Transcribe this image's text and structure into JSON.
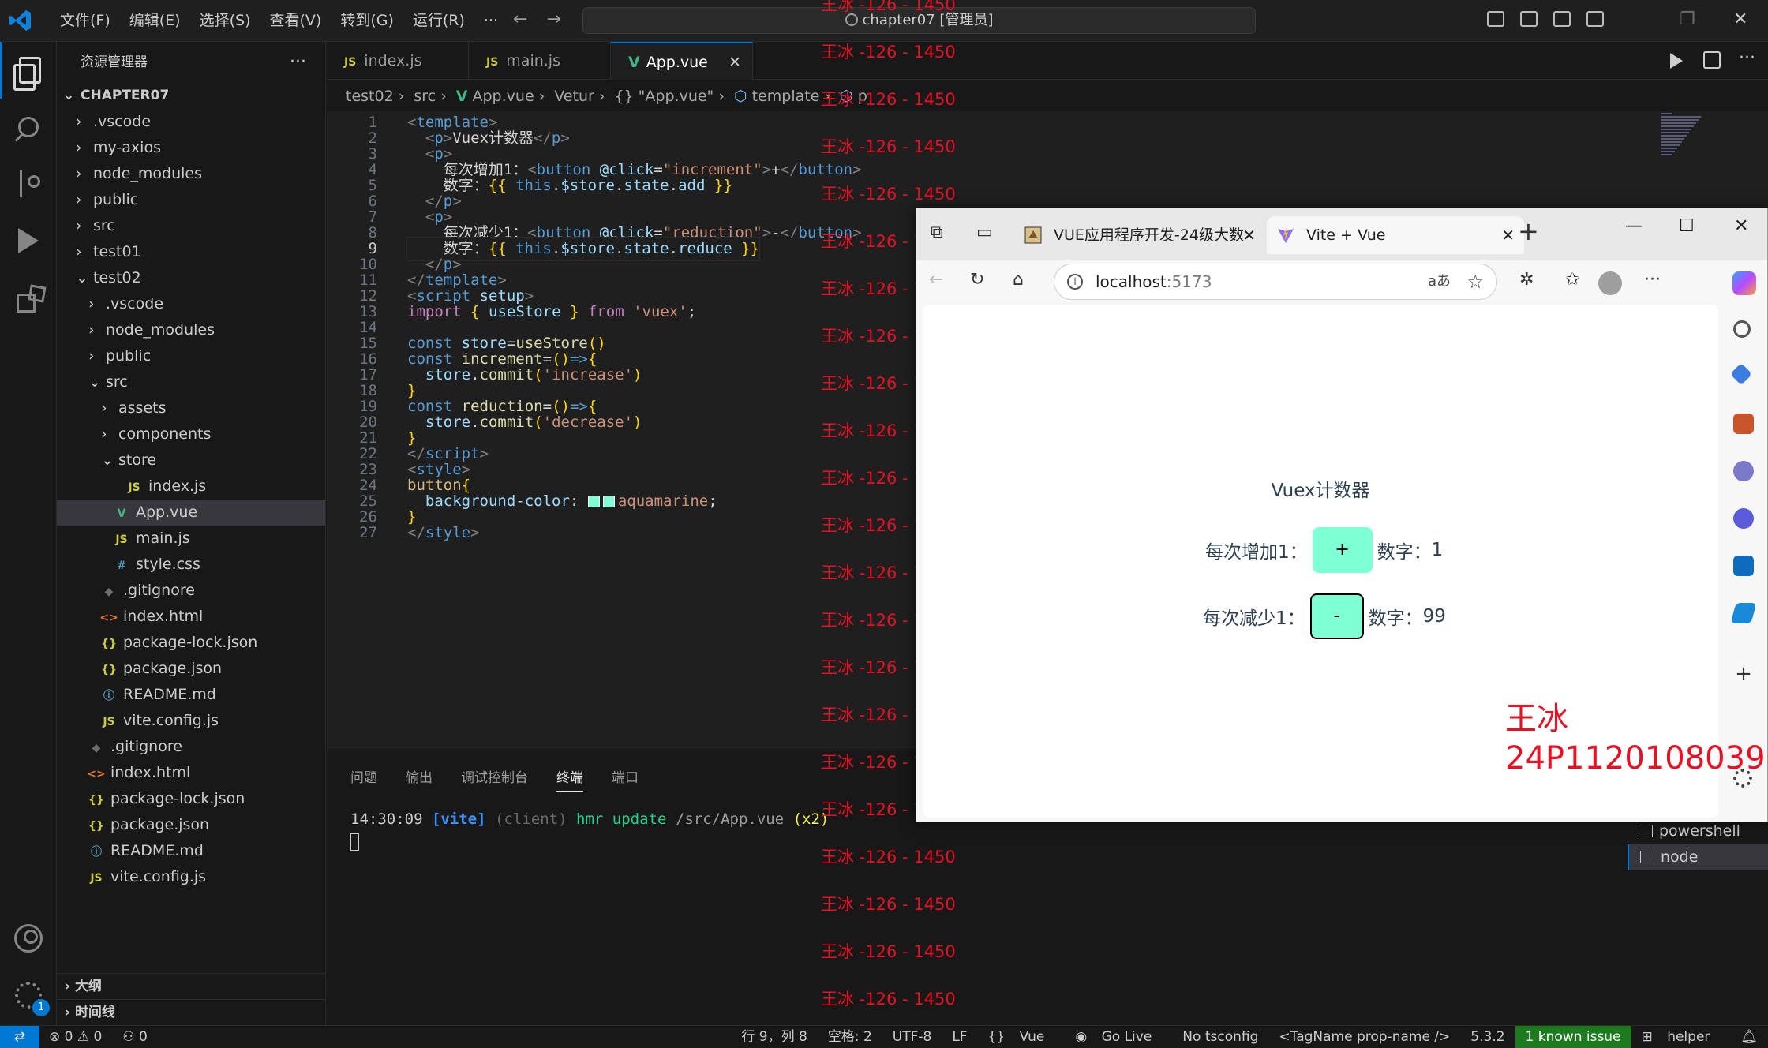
{
  "titlebar": {
    "menu": [
      "文件(F)",
      "编辑(E)",
      "选择(S)",
      "查看(V)",
      "转到(G)",
      "运行(R)",
      "···"
    ],
    "command_center": "chapter07 [管理员]"
  },
  "sidebar": {
    "title": "资源管理器",
    "more": "···",
    "tree": [
      {
        "label": "CHAPTER07",
        "type": "root",
        "depth": 0
      },
      {
        "label": ".vscode",
        "type": "folder",
        "depth": 1
      },
      {
        "label": "my-axios",
        "type": "folder",
        "depth": 1
      },
      {
        "label": "node_modules",
        "type": "folder",
        "depth": 1
      },
      {
        "label": "public",
        "type": "folder",
        "depth": 1
      },
      {
        "label": "src",
        "type": "folder",
        "depth": 1
      },
      {
        "label": "test01",
        "type": "folder",
        "depth": 1
      },
      {
        "label": "test02",
        "type": "folder-open",
        "depth": 1
      },
      {
        "label": ".vscode",
        "type": "folder",
        "depth": 2
      },
      {
        "label": "node_modules",
        "type": "folder",
        "depth": 2
      },
      {
        "label": "public",
        "type": "folder",
        "depth": 2
      },
      {
        "label": "src",
        "type": "folder-open",
        "depth": 2
      },
      {
        "label": "assets",
        "type": "folder",
        "depth": 3
      },
      {
        "label": "components",
        "type": "folder",
        "depth": 3
      },
      {
        "label": "store",
        "type": "folder-open",
        "depth": 3
      },
      {
        "label": "index.js",
        "type": "js",
        "depth": 4
      },
      {
        "label": "App.vue",
        "type": "vue",
        "depth": 3,
        "selected": true
      },
      {
        "label": "main.js",
        "type": "js",
        "depth": 3
      },
      {
        "label": "style.css",
        "type": "css",
        "depth": 3
      },
      {
        "label": ".gitignore",
        "type": "git",
        "depth": 2
      },
      {
        "label": "index.html",
        "type": "html",
        "depth": 2
      },
      {
        "label": "package-lock.json",
        "type": "json",
        "depth": 2
      },
      {
        "label": "package.json",
        "type": "json",
        "depth": 2
      },
      {
        "label": "README.md",
        "type": "info",
        "depth": 2
      },
      {
        "label": "vite.config.js",
        "type": "js",
        "depth": 2
      },
      {
        "label": ".gitignore",
        "type": "git",
        "depth": 1
      },
      {
        "label": "index.html",
        "type": "html",
        "depth": 1
      },
      {
        "label": "package-lock.json",
        "type": "json",
        "depth": 1
      },
      {
        "label": "package.json",
        "type": "json",
        "depth": 1
      },
      {
        "label": "README.md",
        "type": "info",
        "depth": 1
      },
      {
        "label": "vite.config.js",
        "type": "js",
        "depth": 1
      }
    ],
    "outline": "大纲",
    "timeline": "时间线"
  },
  "tabs": [
    {
      "label": "index.js",
      "icon": "JS"
    },
    {
      "label": "main.js",
      "icon": "JS"
    },
    {
      "label": "App.vue",
      "icon": "V",
      "close": "✕"
    }
  ],
  "breadcrumb": [
    "test02",
    "src",
    "App.vue",
    "Vetur",
    "{} \"App.vue\"",
    "template",
    "p"
  ],
  "editor": {
    "current_line": 9,
    "lines": [
      [
        [
          "t-tag",
          "<"
        ],
        [
          "t-tn",
          "template"
        ],
        [
          "t-tag",
          ">"
        ]
      ],
      [
        [
          "t-pl",
          "  "
        ],
        [
          "t-tag",
          "<"
        ],
        [
          "t-tn",
          "p"
        ],
        [
          "t-tag",
          ">"
        ],
        [
          "t-pl",
          "Vuex计数器"
        ],
        [
          "t-tag",
          "</"
        ],
        [
          "t-tn",
          "p"
        ],
        [
          "t-tag",
          ">"
        ]
      ],
      [
        [
          "t-pl",
          "  "
        ],
        [
          "t-tag",
          "<"
        ],
        [
          "t-tn",
          "p"
        ],
        [
          "t-tag",
          ">"
        ]
      ],
      [
        [
          "t-pl",
          "    每次增加1："
        ],
        [
          "t-tag",
          "<"
        ],
        [
          "t-tn",
          "button"
        ],
        [
          "t-pl",
          " "
        ],
        [
          "t-at",
          "@click"
        ],
        [
          "t-pl",
          "="
        ],
        [
          "t-st",
          "\"increment\""
        ],
        [
          "t-tag",
          ">"
        ],
        [
          "t-pl",
          "+"
        ],
        [
          "t-tag",
          "</"
        ],
        [
          "t-tn",
          "button"
        ],
        [
          "t-tag",
          ">"
        ]
      ],
      [
        [
          "t-pl",
          "    数字："
        ],
        [
          "t-br",
          "{{"
        ],
        [
          "t-pl",
          " "
        ],
        [
          "t-kb",
          "this"
        ],
        [
          "t-pl",
          "."
        ],
        [
          "t-vr",
          "$store"
        ],
        [
          "t-pl",
          "."
        ],
        [
          "t-vr",
          "state"
        ],
        [
          "t-pl",
          "."
        ],
        [
          "t-vr",
          "add"
        ],
        [
          "t-pl",
          " "
        ],
        [
          "t-br",
          "}}"
        ]
      ],
      [
        [
          "t-pl",
          "  "
        ],
        [
          "t-tag",
          "</"
        ],
        [
          "t-tn",
          "p"
        ],
        [
          "t-tag",
          ">"
        ]
      ],
      [
        [
          "t-pl",
          "  "
        ],
        [
          "t-tag",
          "<"
        ],
        [
          "t-tn",
          "p"
        ],
        [
          "t-tag",
          ">"
        ]
      ],
      [
        [
          "t-pl",
          "    每次减少1："
        ],
        [
          "t-tag",
          "<"
        ],
        [
          "t-tn",
          "button"
        ],
        [
          "t-pl",
          " "
        ],
        [
          "t-at",
          "@click"
        ],
        [
          "t-pl",
          "="
        ],
        [
          "t-st",
          "\"reduction\""
        ],
        [
          "t-tag",
          ">"
        ],
        [
          "t-pl",
          "-"
        ],
        [
          "t-tag",
          "</"
        ],
        [
          "t-tn",
          "button"
        ],
        [
          "t-tag",
          ">"
        ]
      ],
      [
        [
          "t-pl",
          "    数字："
        ],
        [
          "t-br",
          "{{"
        ],
        [
          "t-pl",
          " "
        ],
        [
          "t-kb",
          "this"
        ],
        [
          "t-pl",
          "."
        ],
        [
          "t-vr",
          "$store"
        ],
        [
          "t-pl",
          "."
        ],
        [
          "t-vr",
          "state"
        ],
        [
          "t-pl",
          "."
        ],
        [
          "t-vr",
          "reduce"
        ],
        [
          "t-pl",
          " "
        ],
        [
          "t-br",
          "}}"
        ]
      ],
      [
        [
          "t-pl",
          "  "
        ],
        [
          "t-tag",
          "</"
        ],
        [
          "t-tn",
          "p"
        ],
        [
          "t-tag",
          ">"
        ]
      ],
      [
        [
          "t-tag",
          "</"
        ],
        [
          "t-tn",
          "template"
        ],
        [
          "t-tag",
          ">"
        ]
      ],
      [
        [
          "t-tag",
          "<"
        ],
        [
          "t-tn",
          "script"
        ],
        [
          "t-pl",
          " "
        ],
        [
          "t-at",
          "setup"
        ],
        [
          "t-tag",
          ">"
        ]
      ],
      [
        [
          "t-kw",
          "import"
        ],
        [
          "t-pl",
          " "
        ],
        [
          "t-br",
          "{"
        ],
        [
          "t-pl",
          " "
        ],
        [
          "t-vr",
          "useStore"
        ],
        [
          "t-pl",
          " "
        ],
        [
          "t-br",
          "}"
        ],
        [
          "t-pl",
          " "
        ],
        [
          "t-kw",
          "from"
        ],
        [
          "t-pl",
          " "
        ],
        [
          "t-st",
          "'vuex'"
        ],
        [
          "t-pl",
          ";"
        ]
      ],
      [],
      [
        [
          "t-kb",
          "const"
        ],
        [
          "t-pl",
          " "
        ],
        [
          "t-vr",
          "store"
        ],
        [
          "t-pl",
          "="
        ],
        [
          "t-fn",
          "useStore"
        ],
        [
          "t-br",
          "()"
        ]
      ],
      [
        [
          "t-kb",
          "const"
        ],
        [
          "t-pl",
          " "
        ],
        [
          "t-fn",
          "increment"
        ],
        [
          "t-pl",
          "="
        ],
        [
          "t-br",
          "()"
        ],
        [
          "t-kb",
          "=>"
        ],
        [
          "t-br",
          "{"
        ]
      ],
      [
        [
          "t-pl",
          "  "
        ],
        [
          "t-vr",
          "store"
        ],
        [
          "t-pl",
          "."
        ],
        [
          "t-fn",
          "commit"
        ],
        [
          "t-br",
          "("
        ],
        [
          "t-st",
          "'increase'"
        ],
        [
          "t-br",
          ")"
        ]
      ],
      [
        [
          "t-br",
          "}"
        ]
      ],
      [
        [
          "t-kb",
          "const"
        ],
        [
          "t-pl",
          " "
        ],
        [
          "t-fn",
          "reduction"
        ],
        [
          "t-pl",
          "="
        ],
        [
          "t-br",
          "()"
        ],
        [
          "t-kb",
          "=>"
        ],
        [
          "t-br",
          "{"
        ]
      ],
      [
        [
          "t-pl",
          "  "
        ],
        [
          "t-vr",
          "store"
        ],
        [
          "t-pl",
          "."
        ],
        [
          "t-fn",
          "commit"
        ],
        [
          "t-br",
          "("
        ],
        [
          "t-st",
          "'decrease'"
        ],
        [
          "t-br",
          ")"
        ]
      ],
      [
        [
          "t-br",
          "}"
        ]
      ],
      [
        [
          "t-tag",
          "</"
        ],
        [
          "t-tn",
          "script"
        ],
        [
          "t-tag",
          ">"
        ]
      ],
      [
        [
          "t-tag",
          "<"
        ],
        [
          "t-tn",
          "style"
        ],
        [
          "t-tag",
          ">"
        ]
      ],
      [
        [
          "t-sel",
          "button"
        ],
        [
          "t-br",
          "{"
        ]
      ],
      [
        [
          "t-pl",
          "  "
        ],
        [
          "t-prop",
          "background-color"
        ],
        [
          "t-pl",
          ": "
        ],
        [
          "swatch",
          ""
        ],
        [
          "t-st",
          "aquamarine"
        ],
        [
          "t-pl",
          ";"
        ]
      ],
      [
        [
          "t-br",
          "}"
        ]
      ],
      [
        [
          "t-tag",
          "</"
        ],
        [
          "t-tn",
          "style"
        ],
        [
          "t-tag",
          ">"
        ]
      ]
    ]
  },
  "panel": {
    "tabs": [
      "问题",
      "输出",
      "调试控制台",
      "终端",
      "端口"
    ],
    "active_tab": "终端",
    "terminal_line": {
      "time": "14:30:09",
      "tag": "[vite]",
      "client": "(client)",
      "msg": "hmr update",
      "path": "/src/App.vue",
      "count": "(x2)"
    },
    "terminals": [
      "powershell",
      "node"
    ]
  },
  "statusbar": {
    "errors": "0",
    "warnings": "0",
    "ports": "0",
    "position": "行 9，列 8",
    "spaces": "空格: 2",
    "encoding": "UTF-8",
    "eol": "LF",
    "language": "Vue",
    "golive": "Go Live",
    "tsconfig": "No tsconfig",
    "tagname": "<TagName prop-name />",
    "version": "5.3.2",
    "issue": "1 known issue",
    "helper": "helper"
  },
  "watermark": {
    "text": "王冰 -126 - 1450",
    "count": 22
  },
  "browser": {
    "tabs": [
      {
        "label": "VUE应用程序开发-24级大数",
        "close": "✕"
      },
      {
        "label": "Vite + Vue",
        "close": "✕"
      }
    ],
    "new_tab": "+",
    "url": "localhost",
    "port": ":5173",
    "read_aloud": "aあ",
    "page": {
      "title": "Vuex计数器",
      "row1_label": "每次增加1：",
      "row1_button": "+",
      "row1_count_label": "数字：",
      "row1_count": "1",
      "row2_label": "每次减少1：",
      "row2_button": "-",
      "row2_count_label": "数字：",
      "row2_count": "99"
    },
    "signature_name": "王冰",
    "signature_id": "24P1120108039"
  },
  "colors": {
    "accent": "#0078d4",
    "button_bg": "#7fffd4",
    "watermark": "#e81123",
    "issue_bg": "#1e7a1e"
  }
}
